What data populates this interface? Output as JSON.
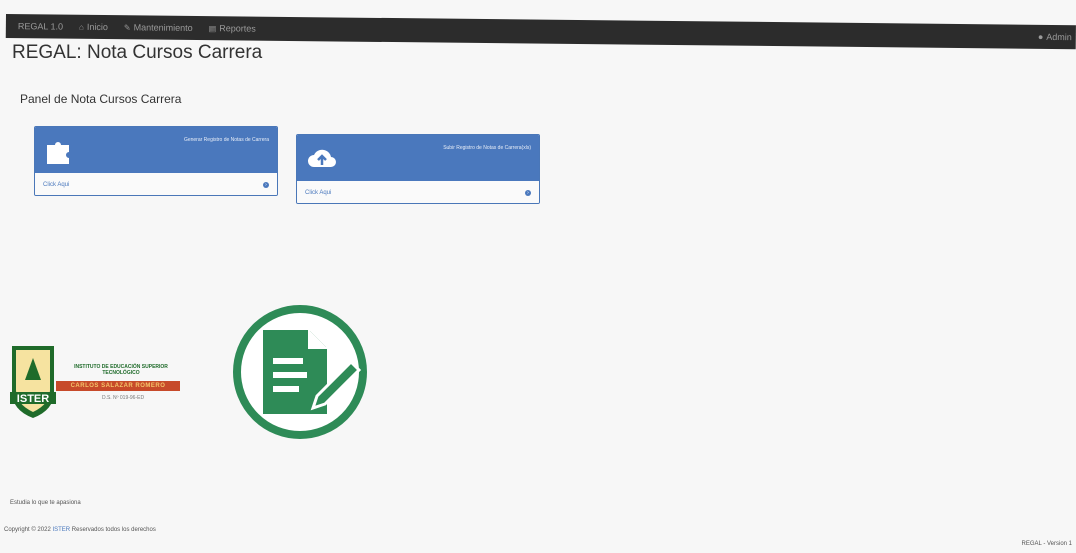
{
  "navbar": {
    "brand": "REGAL 1.0",
    "links": [
      {
        "icon": "home-icon",
        "label": "Inicio"
      },
      {
        "icon": "wrench-icon",
        "label": "Mantenimiento"
      },
      {
        "icon": "report-icon",
        "label": "Reportes"
      }
    ],
    "user": {
      "icon": "user-icon",
      "label": "Admin"
    }
  },
  "page": {
    "title": "REGAL: Nota Cursos Carrera",
    "panel_heading": "Panel de Nota Cursos Carrera"
  },
  "cards": [
    {
      "icon": "puzzle-icon",
      "label": "Generar Registro de Notas de Carrera",
      "link": "Click Aqui"
    },
    {
      "icon": "cloud-upload-icon",
      "label": "Subir Registro de Notas de Carrera(xls)",
      "link": "Click Aqui"
    }
  ],
  "logo": {
    "line1": "INSTITUTO DE EDUCACIÓN SUPERIOR TECNOLÓGICO",
    "line2": "CARLOS SALAZAR ROMERO",
    "line3": "D.S. Nº 019-96-ED",
    "badge_text": "ISTER",
    "colors": {
      "green": "#1f6b2a",
      "orange": "#c74a2a"
    }
  },
  "doc_icon": {
    "color": "#2e8b57"
  },
  "footer": {
    "tagline": "Estudia lo que te apasiona",
    "copyright_prefix": "Copyright © 2022",
    "copyright_link": "ISTER",
    "copyright_suffix": "Reservados todos los derechos",
    "version": "REGAL - Version 1"
  },
  "colors": {
    "primary": "#4a78bd",
    "navbar": "#2c2c2c"
  }
}
